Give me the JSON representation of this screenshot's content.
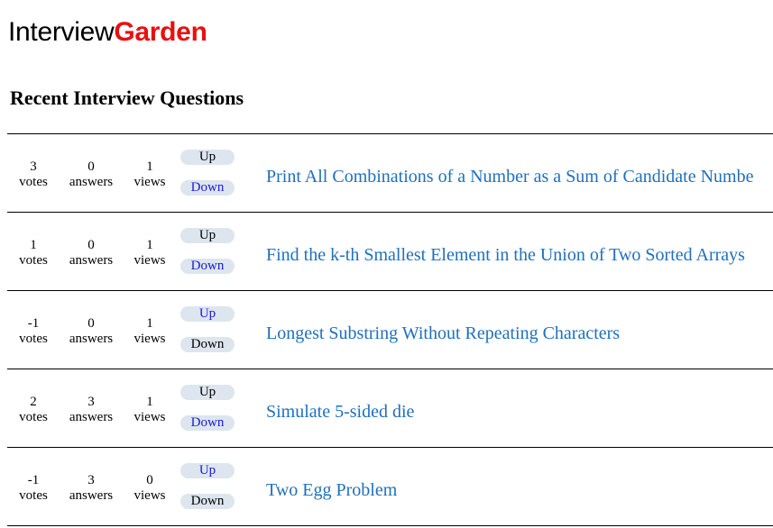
{
  "logo": {
    "part1": "Interview",
    "part2": "Garden"
  },
  "heading": "Recent Interview Questions",
  "questions": [
    {
      "votes": "3",
      "votes_label": "votes",
      "answers": "0",
      "answers_label": "answers",
      "views": "1",
      "views_label": "views",
      "up_label": "Up",
      "down_label": "Down",
      "title": "Print All Combinations of a Number as a Sum of Candidate Numbe"
    },
    {
      "votes": "1",
      "votes_label": "votes",
      "answers": "0",
      "answers_label": "answers",
      "views": "1",
      "views_label": "views",
      "up_label": "Up",
      "down_label": "Down",
      "title": "Find the k-th Smallest Element in the Union of Two Sorted Arrays"
    },
    {
      "votes": "-1",
      "votes_label": "votes",
      "answers": "0",
      "answers_label": "answers",
      "views": "1",
      "views_label": "views",
      "up_label": "Up",
      "down_label": "Down",
      "title": "Longest Substring Without Repeating Characters"
    },
    {
      "votes": "2",
      "votes_label": "votes",
      "answers": "3",
      "answers_label": "answers",
      "views": "1",
      "views_label": "views",
      "up_label": "Up",
      "down_label": "Down",
      "title": "Simulate 5-sided die"
    },
    {
      "votes": "-1",
      "votes_label": "votes",
      "answers": "3",
      "answers_label": "answers",
      "views": "0",
      "views_label": "views",
      "up_label": "Up",
      "down_label": "Down",
      "title": "Two Egg Problem"
    }
  ],
  "colors": {
    "logo_accent": "#e8100f",
    "link": "#1f6fbf",
    "button_bg": "#dde5ee",
    "active_vote_text": "#1a1ad6"
  }
}
